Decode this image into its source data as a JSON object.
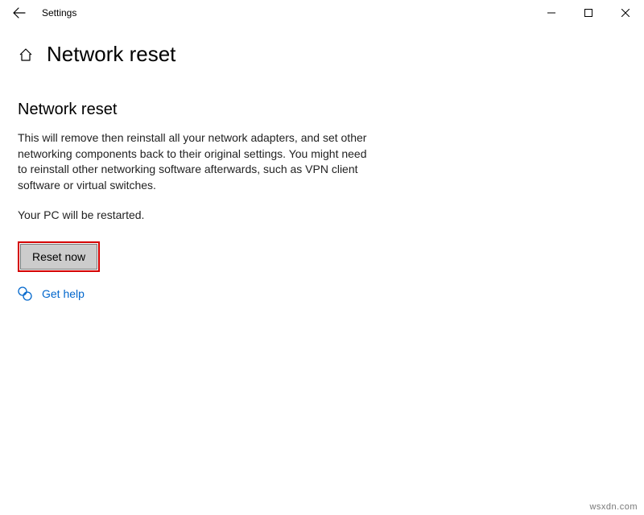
{
  "titlebar": {
    "app_title": "Settings"
  },
  "header": {
    "title": "Network reset"
  },
  "section": {
    "heading": "Network reset",
    "description": "This will remove then reinstall all your network adapters, and set other networking components back to their original settings. You might need to reinstall other networking software afterwards, such as VPN client software or virtual switches.",
    "restart_note": "Your PC will be restarted."
  },
  "actions": {
    "reset_label": "Reset now"
  },
  "help": {
    "label": "Get help"
  },
  "watermark": "wsxdn.com"
}
